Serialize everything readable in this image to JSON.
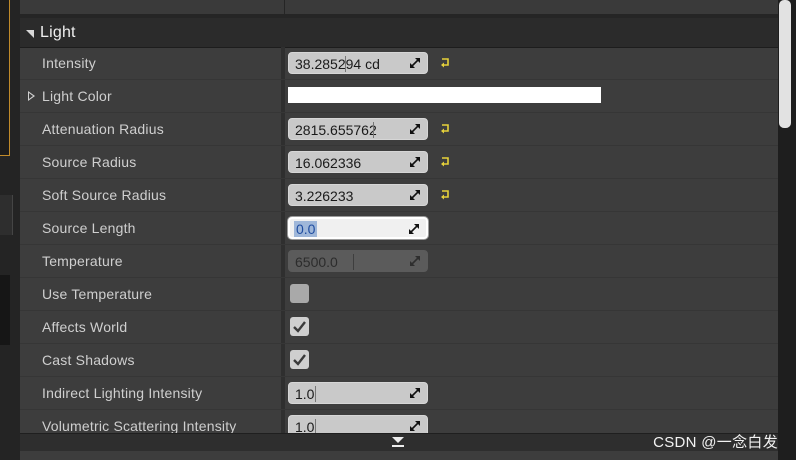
{
  "section": {
    "title": "Light"
  },
  "properties": [
    {
      "label": "Intensity",
      "value": "38.285294 cd"
    },
    {
      "label": "Light Color"
    },
    {
      "label": "Attenuation Radius",
      "value": "2815.655762"
    },
    {
      "label": "Source Radius",
      "value": "16.062336"
    },
    {
      "label": "Soft Source Radius",
      "value": "3.226233"
    },
    {
      "label": "Source Length",
      "value": "0.0"
    },
    {
      "label": "Temperature",
      "value": "6500.0"
    },
    {
      "label": "Use Temperature",
      "checked": false
    },
    {
      "label": "Affects World",
      "checked": true
    },
    {
      "label": "Cast Shadows",
      "checked": true
    },
    {
      "label": "Indirect Lighting Intensity",
      "value": "1.0"
    },
    {
      "label": "Volumetric Scattering Intensity",
      "value": "1.0"
    }
  ],
  "light_color": "#ffffff",
  "icons": {
    "drag": "drag-arrows-icon",
    "reset": "reset-to-default-icon",
    "expand": "expand-arrow-icon",
    "collapse": "collapse-arrow-icon",
    "check": "checkmark-icon",
    "more": "show-advanced-icon"
  },
  "watermark": "CSDN @一念白发"
}
